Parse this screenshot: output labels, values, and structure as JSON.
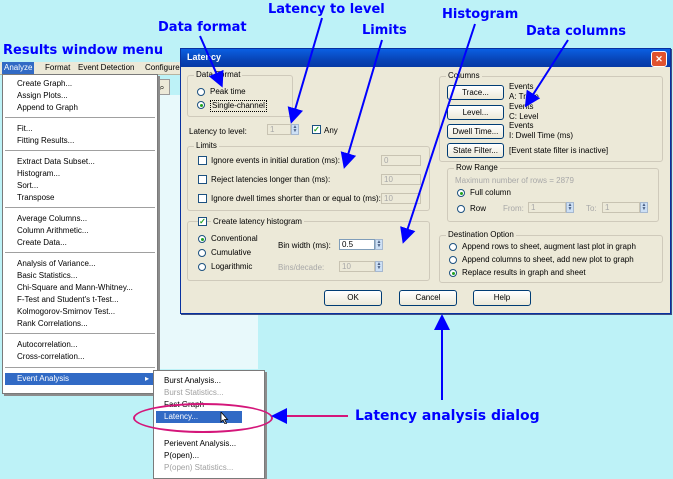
{
  "callouts": {
    "data_format": "Data format",
    "latency_to_level": "Latency to level",
    "limits": "Limits",
    "histogram": "Histogram",
    "data_columns": "Data columns",
    "results_menu": "Results window menu",
    "latency_dialog": "Latency analysis dialog"
  },
  "menubar": {
    "analyze": "Analyze",
    "format": "Format",
    "event_detection": "Event Detection",
    "configure": "Configure"
  },
  "menu": {
    "items": [
      "Create Graph...",
      "Assign Plots...",
      "Append to Graph",
      "Fit...",
      "Fitting Results...",
      "Extract Data Subset...",
      "Histogram...",
      "Sort...",
      "Transpose",
      "Average Columns...",
      "Column Arithmetic...",
      "Create Data...",
      "Analysis of Variance...",
      "Basic Statistics...",
      "Chi-Square and Mann-Whitney...",
      "F-Test and Student's t-Test...",
      "Kolmogorov-Smirnov Test...",
      "Rank Correlations...",
      "Autocorrelation...",
      "Cross-correlation...",
      "Event Analysis"
    ],
    "submenu_arrow": "▸"
  },
  "submenu": {
    "items": [
      "Burst Analysis...",
      "Burst Statistics...",
      "Fast Graph",
      "Latency...",
      "Perievent Analysis...",
      "P(open)...",
      "P(open) Statistics..."
    ]
  },
  "dialog": {
    "title": "Latency",
    "close": "✕",
    "data_format": {
      "title": "Data Format",
      "peak_time": "Peak time",
      "single_channel": "Single-channel"
    },
    "latency_to_level": {
      "label": "Latency to level:",
      "value": "1",
      "any_label": "Any"
    },
    "limits": {
      "title": "Limits",
      "ignore_events": "Ignore events in initial duration (ms):",
      "ignore_events_value": "0",
      "reject": "Reject latencies longer than (ms):",
      "reject_value": "10",
      "ignore_dwell": "Ignore dwell times shorter than or equal to (ms):",
      "ignore_dwell_value": "10"
    },
    "histogram": {
      "create": "Create latency histogram",
      "conventional": "Conventional",
      "cumulative": "Cumulative",
      "logarithmic": "Logarithmic",
      "bin_width_label": "Bin width (ms):",
      "bin_width_value": "0.5",
      "bins_decade_label": "Bins/decade:",
      "bins_decade_value": "10"
    },
    "columns": {
      "title": "Columns",
      "trace_btn": "Trace...",
      "trace_desc1": "Events",
      "trace_desc2": "A: Trace",
      "level_btn": "Level...",
      "level_desc1": "Events",
      "level_desc2": "C: Level",
      "dwell_btn": "Dwell Time...",
      "dwell_desc1": "Events",
      "dwell_desc2": "I: Dwell Time (ms)",
      "state_btn": "State Filter...",
      "state_desc": "[Event state filter is inactive]"
    },
    "row_range": {
      "title": "Row Range",
      "max_rows": "Maximum number of rows = 2879",
      "full_column": "Full column",
      "row": "Row",
      "from": "From:",
      "from_value": "1",
      "to": "To:",
      "to_value": "1"
    },
    "destination": {
      "title": "Destination Option",
      "opt1": "Append rows to sheet, augment last plot in graph",
      "opt2": "Append columns to sheet, add new plot to graph",
      "opt3": "Replace results in graph and sheet"
    },
    "buttons": {
      "ok": "OK",
      "cancel": "Cancel",
      "help": "Help"
    }
  },
  "colors": {
    "background": "#bdf2f7",
    "callout": "#0000ff",
    "highlight": "#316ac5",
    "ellipse": "#d4167a",
    "titlebar": "#0844b6"
  }
}
